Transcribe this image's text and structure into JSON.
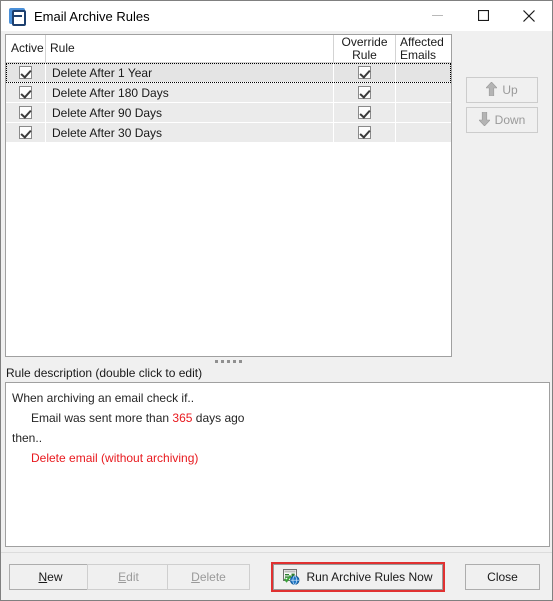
{
  "window": {
    "title": "Email Archive Rules",
    "icon": "app-archive-icon",
    "controls": {
      "minimize": "minimize-icon",
      "maximize": "maximize-icon",
      "close": "close-icon"
    }
  },
  "grid": {
    "columns": [
      {
        "key": "active",
        "label": "Active"
      },
      {
        "key": "rule",
        "label": "Rule"
      },
      {
        "key": "override",
        "label": "Override\nRule"
      },
      {
        "key": "affected",
        "label": "Affected\nEmails"
      }
    ],
    "rows": [
      {
        "active": true,
        "rule": "Delete After 1 Year",
        "override": true,
        "affected": "",
        "selected": true
      },
      {
        "active": true,
        "rule": "Delete After 180 Days",
        "override": true,
        "affected": "",
        "selected": false
      },
      {
        "active": true,
        "rule": "Delete After 90 Days",
        "override": true,
        "affected": "",
        "selected": false
      },
      {
        "active": true,
        "rule": "Delete After 30 Days",
        "override": true,
        "affected": "",
        "selected": false
      }
    ]
  },
  "sidepanel": {
    "up_label": "Up",
    "down_label": "Down",
    "up_icon": "arrow-up-icon",
    "down_icon": "arrow-down-icon",
    "up_enabled": false,
    "down_enabled": false
  },
  "description": {
    "label": "Rule description (double click to edit)",
    "line1": "When archiving an email check if..",
    "line2_prefix": "Email was sent more than ",
    "line2_value": "365",
    "line2_suffix": " days ago",
    "line3": "then..",
    "line4": "Delete email (without archiving)"
  },
  "buttons": {
    "new": {
      "label": "New",
      "accel": "N",
      "enabled": true
    },
    "edit": {
      "label": "Edit",
      "accel": "E",
      "enabled": false
    },
    "delete": {
      "label": "Delete",
      "accel": "D",
      "enabled": false
    },
    "run": {
      "label": "Run Archive Rules Now",
      "icon": "run-rules-icon",
      "enabled": true,
      "default": true
    },
    "close": {
      "label": "Close",
      "enabled": true
    }
  },
  "colors": {
    "accent_red": "#e8191e",
    "default_button_outline": "#e03131",
    "title_icon_blue": "#4a90d9",
    "row_background": "#ebebeb",
    "panel_background": "#f0f0f0"
  }
}
